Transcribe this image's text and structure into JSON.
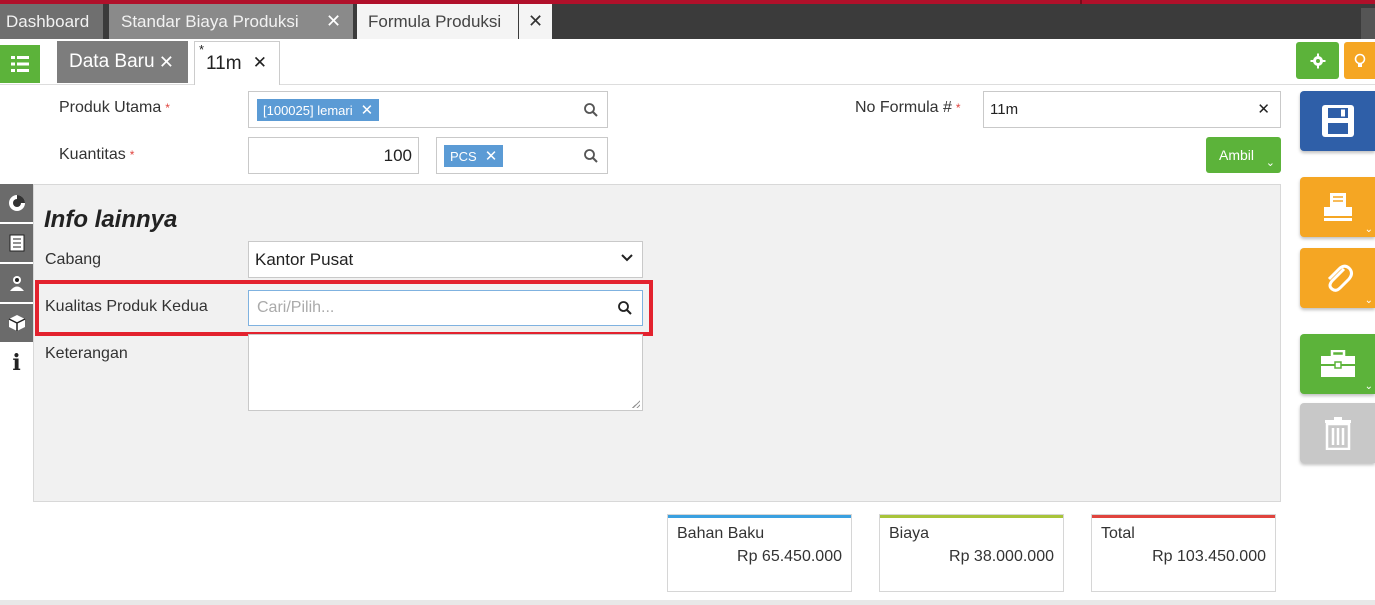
{
  "main_tabs": [
    {
      "label": "Dashboard"
    },
    {
      "label": "Standar Biaya Produksi"
    },
    {
      "label": "Formula Produksi"
    }
  ],
  "sub_tabs": {
    "new_label": "Data Baru",
    "current_label": "11m",
    "modified_marker": "*"
  },
  "form": {
    "produk_utama_label": "Produk Utama",
    "produk_utama_tag": "[100025] lemari",
    "kuantitas_label": "Kuantitas",
    "kuantitas_value": "100",
    "unit_tag": "PCS",
    "no_formula_label": "No Formula #",
    "no_formula_value": "11m",
    "required_marker": "*",
    "ambil_label": "Ambil"
  },
  "info": {
    "title": "Info lainnya",
    "cabang_label": "Cabang",
    "cabang_value": "Kantor Pusat",
    "kualitas_label": "Kualitas Produk Kedua",
    "kualitas_placeholder": "Cari/Pilih...",
    "keterangan_label": "Keterangan"
  },
  "totals": [
    {
      "title": "Bahan Baku",
      "value": "Rp 65.450.000",
      "color": "#3aa0e0"
    },
    {
      "title": "Biaya",
      "value": "Rp 38.000.000",
      "color": "#a8c43a"
    },
    {
      "title": "Total",
      "value": "Rp 103.450.000",
      "color": "#e0443e"
    }
  ],
  "colors": {
    "accent_green": "#5cb33a",
    "save_blue": "#2f5fa8",
    "orange": "#f5a623",
    "tag_blue": "#5b9bd5",
    "highlight_red": "#e3222e"
  },
  "icons": {
    "menu": "list-icon",
    "save": "save-icon",
    "print": "print-icon",
    "attach": "paperclip-icon",
    "tools": "briefcase-icon",
    "delete": "trash-icon",
    "settings": "gear-icon",
    "tips": "lightbulb-icon"
  }
}
